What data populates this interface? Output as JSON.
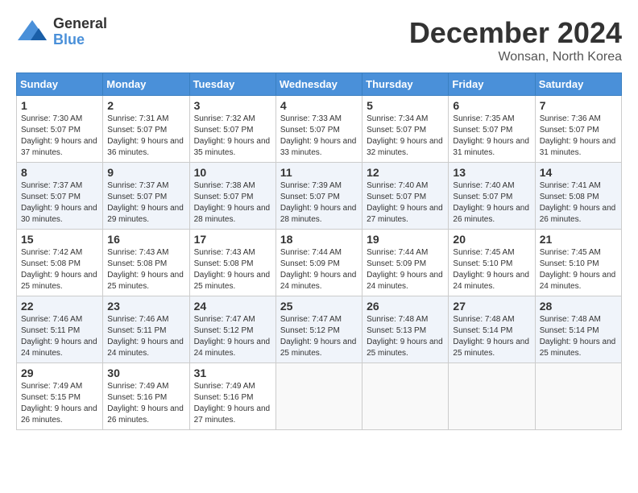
{
  "header": {
    "logo_general": "General",
    "logo_blue": "Blue",
    "month_year": "December 2024",
    "location": "Wonsan, North Korea"
  },
  "days_of_week": [
    "Sunday",
    "Monday",
    "Tuesday",
    "Wednesday",
    "Thursday",
    "Friday",
    "Saturday"
  ],
  "weeks": [
    [
      {
        "day": "1",
        "sunrise": "Sunrise: 7:30 AM",
        "sunset": "Sunset: 5:07 PM",
        "daylight": "Daylight: 9 hours and 37 minutes."
      },
      {
        "day": "2",
        "sunrise": "Sunrise: 7:31 AM",
        "sunset": "Sunset: 5:07 PM",
        "daylight": "Daylight: 9 hours and 36 minutes."
      },
      {
        "day": "3",
        "sunrise": "Sunrise: 7:32 AM",
        "sunset": "Sunset: 5:07 PM",
        "daylight": "Daylight: 9 hours and 35 minutes."
      },
      {
        "day": "4",
        "sunrise": "Sunrise: 7:33 AM",
        "sunset": "Sunset: 5:07 PM",
        "daylight": "Daylight: 9 hours and 33 minutes."
      },
      {
        "day": "5",
        "sunrise": "Sunrise: 7:34 AM",
        "sunset": "Sunset: 5:07 PM",
        "daylight": "Daylight: 9 hours and 32 minutes."
      },
      {
        "day": "6",
        "sunrise": "Sunrise: 7:35 AM",
        "sunset": "Sunset: 5:07 PM",
        "daylight": "Daylight: 9 hours and 31 minutes."
      },
      {
        "day": "7",
        "sunrise": "Sunrise: 7:36 AM",
        "sunset": "Sunset: 5:07 PM",
        "daylight": "Daylight: 9 hours and 31 minutes."
      }
    ],
    [
      {
        "day": "8",
        "sunrise": "Sunrise: 7:37 AM",
        "sunset": "Sunset: 5:07 PM",
        "daylight": "Daylight: 9 hours and 30 minutes."
      },
      {
        "day": "9",
        "sunrise": "Sunrise: 7:37 AM",
        "sunset": "Sunset: 5:07 PM",
        "daylight": "Daylight: 9 hours and 29 minutes."
      },
      {
        "day": "10",
        "sunrise": "Sunrise: 7:38 AM",
        "sunset": "Sunset: 5:07 PM",
        "daylight": "Daylight: 9 hours and 28 minutes."
      },
      {
        "day": "11",
        "sunrise": "Sunrise: 7:39 AM",
        "sunset": "Sunset: 5:07 PM",
        "daylight": "Daylight: 9 hours and 28 minutes."
      },
      {
        "day": "12",
        "sunrise": "Sunrise: 7:40 AM",
        "sunset": "Sunset: 5:07 PM",
        "daylight": "Daylight: 9 hours and 27 minutes."
      },
      {
        "day": "13",
        "sunrise": "Sunrise: 7:40 AM",
        "sunset": "Sunset: 5:07 PM",
        "daylight": "Daylight: 9 hours and 26 minutes."
      },
      {
        "day": "14",
        "sunrise": "Sunrise: 7:41 AM",
        "sunset": "Sunset: 5:08 PM",
        "daylight": "Daylight: 9 hours and 26 minutes."
      }
    ],
    [
      {
        "day": "15",
        "sunrise": "Sunrise: 7:42 AM",
        "sunset": "Sunset: 5:08 PM",
        "daylight": "Daylight: 9 hours and 25 minutes."
      },
      {
        "day": "16",
        "sunrise": "Sunrise: 7:43 AM",
        "sunset": "Sunset: 5:08 PM",
        "daylight": "Daylight: 9 hours and 25 minutes."
      },
      {
        "day": "17",
        "sunrise": "Sunrise: 7:43 AM",
        "sunset": "Sunset: 5:08 PM",
        "daylight": "Daylight: 9 hours and 25 minutes."
      },
      {
        "day": "18",
        "sunrise": "Sunrise: 7:44 AM",
        "sunset": "Sunset: 5:09 PM",
        "daylight": "Daylight: 9 hours and 24 minutes."
      },
      {
        "day": "19",
        "sunrise": "Sunrise: 7:44 AM",
        "sunset": "Sunset: 5:09 PM",
        "daylight": "Daylight: 9 hours and 24 minutes."
      },
      {
        "day": "20",
        "sunrise": "Sunrise: 7:45 AM",
        "sunset": "Sunset: 5:10 PM",
        "daylight": "Daylight: 9 hours and 24 minutes."
      },
      {
        "day": "21",
        "sunrise": "Sunrise: 7:45 AM",
        "sunset": "Sunset: 5:10 PM",
        "daylight": "Daylight: 9 hours and 24 minutes."
      }
    ],
    [
      {
        "day": "22",
        "sunrise": "Sunrise: 7:46 AM",
        "sunset": "Sunset: 5:11 PM",
        "daylight": "Daylight: 9 hours and 24 minutes."
      },
      {
        "day": "23",
        "sunrise": "Sunrise: 7:46 AM",
        "sunset": "Sunset: 5:11 PM",
        "daylight": "Daylight: 9 hours and 24 minutes."
      },
      {
        "day": "24",
        "sunrise": "Sunrise: 7:47 AM",
        "sunset": "Sunset: 5:12 PM",
        "daylight": "Daylight: 9 hours and 24 minutes."
      },
      {
        "day": "25",
        "sunrise": "Sunrise: 7:47 AM",
        "sunset": "Sunset: 5:12 PM",
        "daylight": "Daylight: 9 hours and 25 minutes."
      },
      {
        "day": "26",
        "sunrise": "Sunrise: 7:48 AM",
        "sunset": "Sunset: 5:13 PM",
        "daylight": "Daylight: 9 hours and 25 minutes."
      },
      {
        "day": "27",
        "sunrise": "Sunrise: 7:48 AM",
        "sunset": "Sunset: 5:14 PM",
        "daylight": "Daylight: 9 hours and 25 minutes."
      },
      {
        "day": "28",
        "sunrise": "Sunrise: 7:48 AM",
        "sunset": "Sunset: 5:14 PM",
        "daylight": "Daylight: 9 hours and 25 minutes."
      }
    ],
    [
      {
        "day": "29",
        "sunrise": "Sunrise: 7:49 AM",
        "sunset": "Sunset: 5:15 PM",
        "daylight": "Daylight: 9 hours and 26 minutes."
      },
      {
        "day": "30",
        "sunrise": "Sunrise: 7:49 AM",
        "sunset": "Sunset: 5:16 PM",
        "daylight": "Daylight: 9 hours and 26 minutes."
      },
      {
        "day": "31",
        "sunrise": "Sunrise: 7:49 AM",
        "sunset": "Sunset: 5:16 PM",
        "daylight": "Daylight: 9 hours and 27 minutes."
      },
      null,
      null,
      null,
      null
    ]
  ]
}
